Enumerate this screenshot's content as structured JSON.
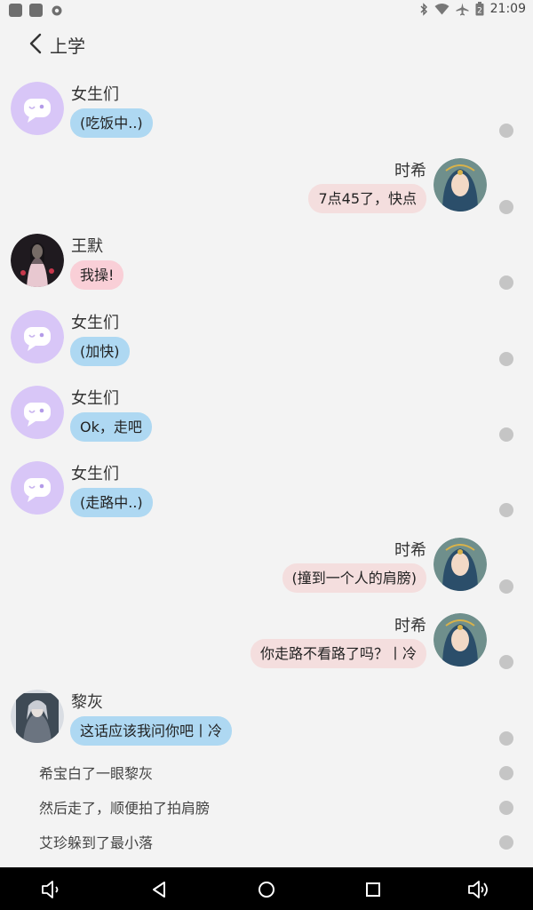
{
  "status_bar": {
    "time": "21:09",
    "battery": "2"
  },
  "header": {
    "title": "上学"
  },
  "messages": [
    {
      "name": "女生们",
      "text": "(吃饭中..)"
    },
    {
      "name": "时希",
      "text": "7点45了，快点"
    },
    {
      "name": "王默",
      "text": "我操!"
    },
    {
      "name": "女生们",
      "text": "(加快)"
    },
    {
      "name": "女生们",
      "text": "Ok，走吧"
    },
    {
      "name": "女生们",
      "text": "(走路中..)"
    },
    {
      "name": "时希",
      "text": "(撞到一个人的肩膀)"
    },
    {
      "name": "时希",
      "text": "你走路不看路了吗？丨冷"
    },
    {
      "name": "黎灰",
      "text": "这话应该我问你吧丨冷"
    }
  ],
  "narration": [
    "希宝白了一眼黎灰",
    "然后走了，顺便拍了拍肩膀",
    "艾珍躲到了最小落"
  ],
  "icons": {
    "back": "chevron-left-icon",
    "group_avatar": "chat-bubble-icon",
    "nav": [
      "volume-down-icon",
      "back-triangle-icon",
      "home-circle-icon",
      "recents-square-icon",
      "volume-up-icon"
    ]
  },
  "colors": {
    "blue_bubble": "#aed8f2",
    "pink_bubble": "#f4dede",
    "rose_bubble": "#f9cfd7",
    "group_avatar": "#d8c6f7"
  }
}
